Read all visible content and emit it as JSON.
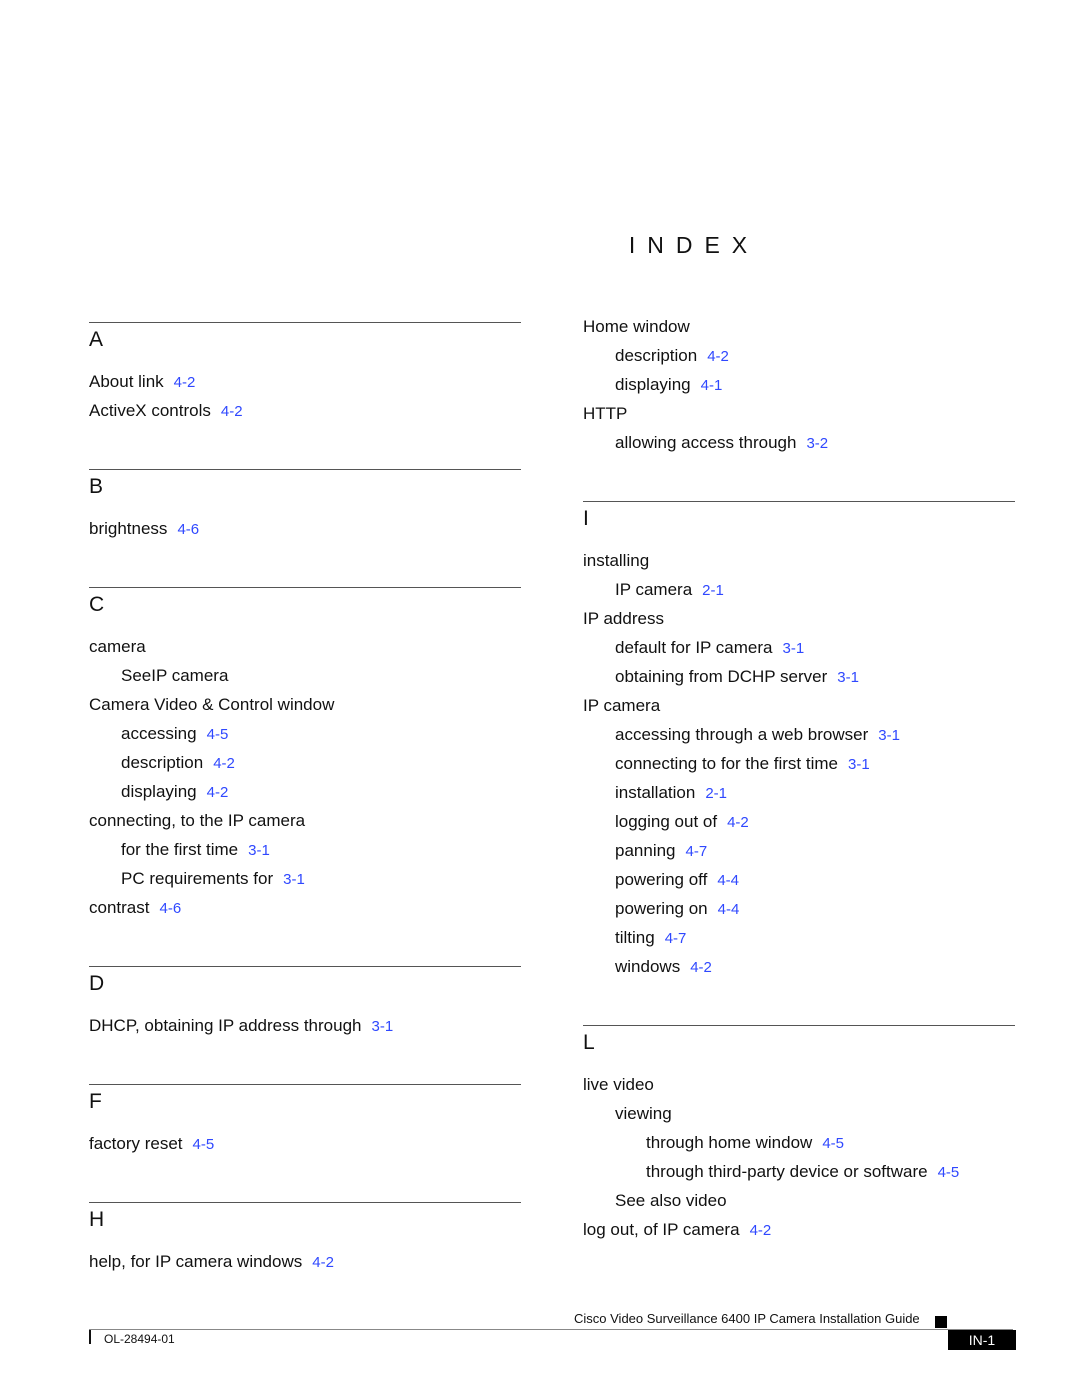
{
  "page_title": "INDEX",
  "colors": {
    "link": "#2f48ff",
    "text": "#111111",
    "rule": "#555555"
  },
  "left_column": [
    {
      "letter": "A",
      "entries": [
        {
          "level": 1,
          "text": "About link",
          "ref": "4-2"
        },
        {
          "level": 1,
          "text": "ActiveX controls",
          "ref": "4-2"
        }
      ]
    },
    {
      "letter": "B",
      "entries": [
        {
          "level": 1,
          "text": "brightness",
          "ref": "4-6"
        }
      ]
    },
    {
      "letter": "C",
      "entries": [
        {
          "level": 1,
          "text": "camera",
          "ref": ""
        },
        {
          "level": 2,
          "text": "SeeIP camera",
          "ref": ""
        },
        {
          "level": 1,
          "text": "Camera Video & Control window",
          "ref": ""
        },
        {
          "level": 2,
          "text": "accessing",
          "ref": "4-5"
        },
        {
          "level": 2,
          "text": "description",
          "ref": "4-2"
        },
        {
          "level": 2,
          "text": "displaying",
          "ref": "4-2"
        },
        {
          "level": 1,
          "text": "connecting, to the IP camera",
          "ref": ""
        },
        {
          "level": 2,
          "text": "for the first time",
          "ref": "3-1"
        },
        {
          "level": 2,
          "text": "PC requirements for",
          "ref": "3-1"
        },
        {
          "level": 1,
          "text": "contrast",
          "ref": "4-6"
        }
      ]
    },
    {
      "letter": "D",
      "entries": [
        {
          "level": 1,
          "text": "DHCP, obtaining IP address through",
          "ref": "3-1"
        }
      ]
    },
    {
      "letter": "F",
      "entries": [
        {
          "level": 1,
          "text": "factory reset",
          "ref": "4-5"
        }
      ]
    },
    {
      "letter": "H",
      "entries": [
        {
          "level": 1,
          "text": "help, for IP camera windows",
          "ref": "4-2"
        }
      ]
    }
  ],
  "right_column_continuation": [
    {
      "level": 1,
      "text": "Home window",
      "ref": ""
    },
    {
      "level": 2,
      "text": "description",
      "ref": "4-2"
    },
    {
      "level": 2,
      "text": "displaying",
      "ref": "4-1"
    },
    {
      "level": 1,
      "text": "HTTP",
      "ref": ""
    },
    {
      "level": 2,
      "text": "allowing access through",
      "ref": "3-2"
    }
  ],
  "right_column": [
    {
      "letter": "I",
      "entries": [
        {
          "level": 1,
          "text": "installing",
          "ref": ""
        },
        {
          "level": 2,
          "text": "IP camera",
          "ref": "2-1"
        },
        {
          "level": 1,
          "text": "IP address",
          "ref": ""
        },
        {
          "level": 2,
          "text": "default for IP camera",
          "ref": "3-1"
        },
        {
          "level": 2,
          "text": "obtaining from DCHP server",
          "ref": "3-1"
        },
        {
          "level": 1,
          "text": "IP camera",
          "ref": ""
        },
        {
          "level": 2,
          "text": "accessing through a web browser",
          "ref": "3-1"
        },
        {
          "level": 2,
          "text": "connecting to for the first time",
          "ref": "3-1"
        },
        {
          "level": 2,
          "text": "installation",
          "ref": "2-1"
        },
        {
          "level": 2,
          "text": "logging out of",
          "ref": "4-2"
        },
        {
          "level": 2,
          "text": "panning",
          "ref": "4-7"
        },
        {
          "level": 2,
          "text": "powering off",
          "ref": "4-4"
        },
        {
          "level": 2,
          "text": "powering on",
          "ref": "4-4"
        },
        {
          "level": 2,
          "text": "tilting",
          "ref": "4-7"
        },
        {
          "level": 2,
          "text": "windows",
          "ref": "4-2"
        }
      ]
    },
    {
      "letter": "L",
      "entries": [
        {
          "level": 1,
          "text": "live video",
          "ref": ""
        },
        {
          "level": 2,
          "text": "viewing",
          "ref": ""
        },
        {
          "level": 3,
          "text": "through home window",
          "ref": "4-5"
        },
        {
          "level": 3,
          "text": "through third-party device or software",
          "ref": "4-5"
        },
        {
          "level": 2,
          "text": "See also video",
          "ref": ""
        },
        {
          "level": 1,
          "text": "log out, of IP camera",
          "ref": "4-2"
        }
      ]
    }
  ],
  "footer": {
    "guide_title": "Cisco Video Surveillance 6400 IP Camera Installation Guide",
    "doc_number": "OL-28494-01",
    "page_number": "IN-1"
  }
}
